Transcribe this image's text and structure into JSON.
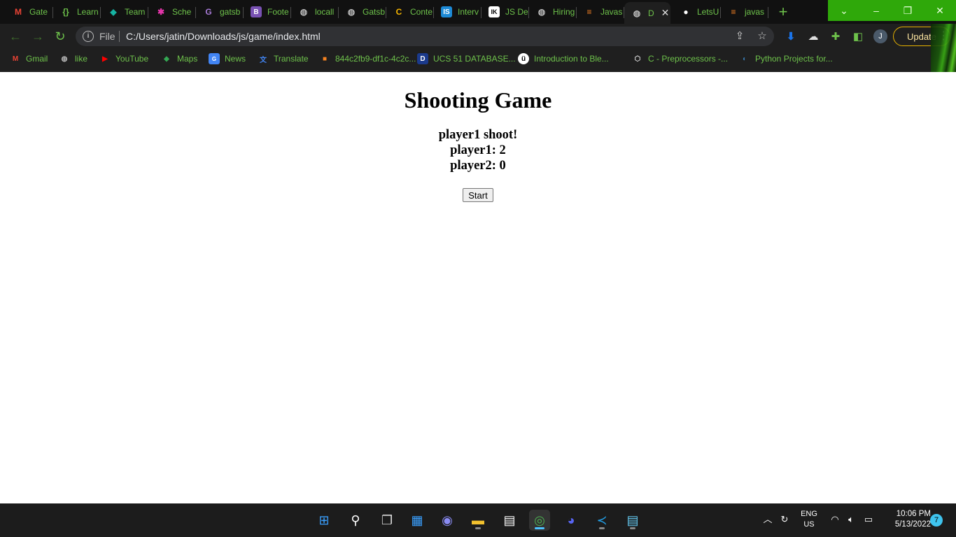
{
  "browser": {
    "tabs": [
      {
        "label": "Gate",
        "icon": "gmail-icon",
        "glyph": "M",
        "color": "#ea4335"
      },
      {
        "label": "Learn",
        "icon": "brackets-icon",
        "glyph": "{}",
        "color": "#6ec24b"
      },
      {
        "label": "Team",
        "icon": "diamond-icon",
        "glyph": "◆",
        "color": "#16b3a2"
      },
      {
        "label": "Sche",
        "icon": "graphql-icon",
        "glyph": "✱",
        "color": "#e535ab"
      },
      {
        "label": "gatsb",
        "icon": "gatsby-icon",
        "glyph": "G",
        "color": "#a77ad6"
      },
      {
        "label": "Foote",
        "icon": "bootstrap-icon",
        "glyph": "B",
        "color": "#7952b3"
      },
      {
        "label": "locall",
        "icon": "globe-icon",
        "glyph": "◍",
        "color": "#bbbbbb"
      },
      {
        "label": "Gatsb",
        "icon": "globe-icon",
        "glyph": "◍",
        "color": "#bbbbbb"
      },
      {
        "label": "Conte",
        "icon": "contentful-icon",
        "glyph": "C",
        "color": "#f5b500"
      },
      {
        "label": "Interv",
        "icon": "interviewbit-icon",
        "glyph": "IS",
        "color": "#1d8ad6"
      },
      {
        "label": "JS De",
        "icon": "ik-icon",
        "glyph": "IK",
        "color": "#222222"
      },
      {
        "label": "Hiring",
        "icon": "globe-icon",
        "glyph": "◍",
        "color": "#bbbbbb"
      },
      {
        "label": "Javas",
        "icon": "stackoverflow-icon",
        "glyph": "≡",
        "color": "#f48024"
      },
      {
        "label": "D",
        "icon": "globe-icon",
        "glyph": "◍",
        "color": "#bbbbbb",
        "active": true
      },
      {
        "label": "LetsU",
        "icon": "github-icon",
        "glyph": "●",
        "color": "#ffffff"
      },
      {
        "label": "javas",
        "icon": "stackoverflow-icon",
        "glyph": "≡",
        "color": "#f48024"
      }
    ],
    "new_tab_glyph": "+",
    "window_controls": {
      "dropdown": "⌄",
      "minimize": "–",
      "restore": "❐",
      "close": "✕"
    },
    "toolbar": {
      "back": "←",
      "forward": "→",
      "reload": "↻",
      "file_label": "File",
      "url": "C:/Users/jatin/Downloads/js/game/index.html",
      "share": "⇪",
      "star": "☆",
      "update_label": "Update",
      "avatar_initial": "J",
      "more": "⋮"
    },
    "bookmarks": [
      {
        "label": "Gmail",
        "icon": "gmail-icon",
        "glyph": "M",
        "color": "#ea4335"
      },
      {
        "label": "like",
        "icon": "globe-icon",
        "glyph": "◍",
        "color": "#bbbbbb"
      },
      {
        "label": "YouTube",
        "icon": "youtube-icon",
        "glyph": "▶",
        "color": "#ff0000"
      },
      {
        "label": "Maps",
        "icon": "maps-icon",
        "glyph": "◆",
        "color": "#34a853"
      },
      {
        "label": "News",
        "icon": "news-icon",
        "glyph": "G",
        "color": "#4285f4"
      },
      {
        "label": "Translate",
        "icon": "translate-icon",
        "glyph": "文",
        "color": "#4285f4"
      },
      {
        "label": "844c2fb9-df1c-4c2c...",
        "icon": "cube-icon",
        "glyph": "■",
        "color": "#f58220"
      },
      {
        "label": "UCS 51 DATABASE...",
        "icon": "d-icon",
        "glyph": "D",
        "color": "#1b3a8c"
      },
      {
        "label": "Introduction to Ble...",
        "icon": "udemy-icon",
        "glyph": "ü",
        "color": "#ffffff"
      },
      {
        "label": "C - Preprocessors -...",
        "icon": "gfg-icon",
        "glyph": "⬡",
        "color": "#dddddd"
      },
      {
        "label": "Python Projects for...",
        "icon": "python-icon",
        "glyph": "◐",
        "color": "#3776ab"
      }
    ]
  },
  "page": {
    "title": "Shooting Game",
    "status": "player1 shoot!",
    "player1_score": "player1: 2",
    "player2_score": "player2: 0",
    "start_label": "Start"
  },
  "taskbar": {
    "apps": [
      {
        "name": "windows-start-icon",
        "glyph": "⊞",
        "color": "#3aa0ff"
      },
      {
        "name": "search-icon",
        "glyph": "⚲",
        "color": "#ffffff"
      },
      {
        "name": "task-view-icon",
        "glyph": "❐",
        "color": "#dddddd"
      },
      {
        "name": "widgets-icon",
        "glyph": "▦",
        "color": "#3aa0ff"
      },
      {
        "name": "teams-chat-icon",
        "glyph": "◉",
        "color": "#8b8cf5"
      },
      {
        "name": "file-explorer-icon",
        "glyph": "▬",
        "color": "#f2c12e"
      },
      {
        "name": "store-icon",
        "glyph": "▤",
        "color": "#ffffff"
      },
      {
        "name": "chrome-icon",
        "glyph": "◎",
        "color": "#4caf50",
        "active": true
      },
      {
        "name": "discord-icon",
        "glyph": "◕",
        "color": "#5865f2"
      },
      {
        "name": "vscode-icon",
        "glyph": "≺",
        "color": "#22a0e8"
      },
      {
        "name": "notepad-icon",
        "glyph": "▤",
        "color": "#64c8f0"
      }
    ],
    "lang_line1": "ENG",
    "lang_line2": "US",
    "time": "10:06 PM",
    "date": "5/13/2022",
    "notifications": "7"
  }
}
